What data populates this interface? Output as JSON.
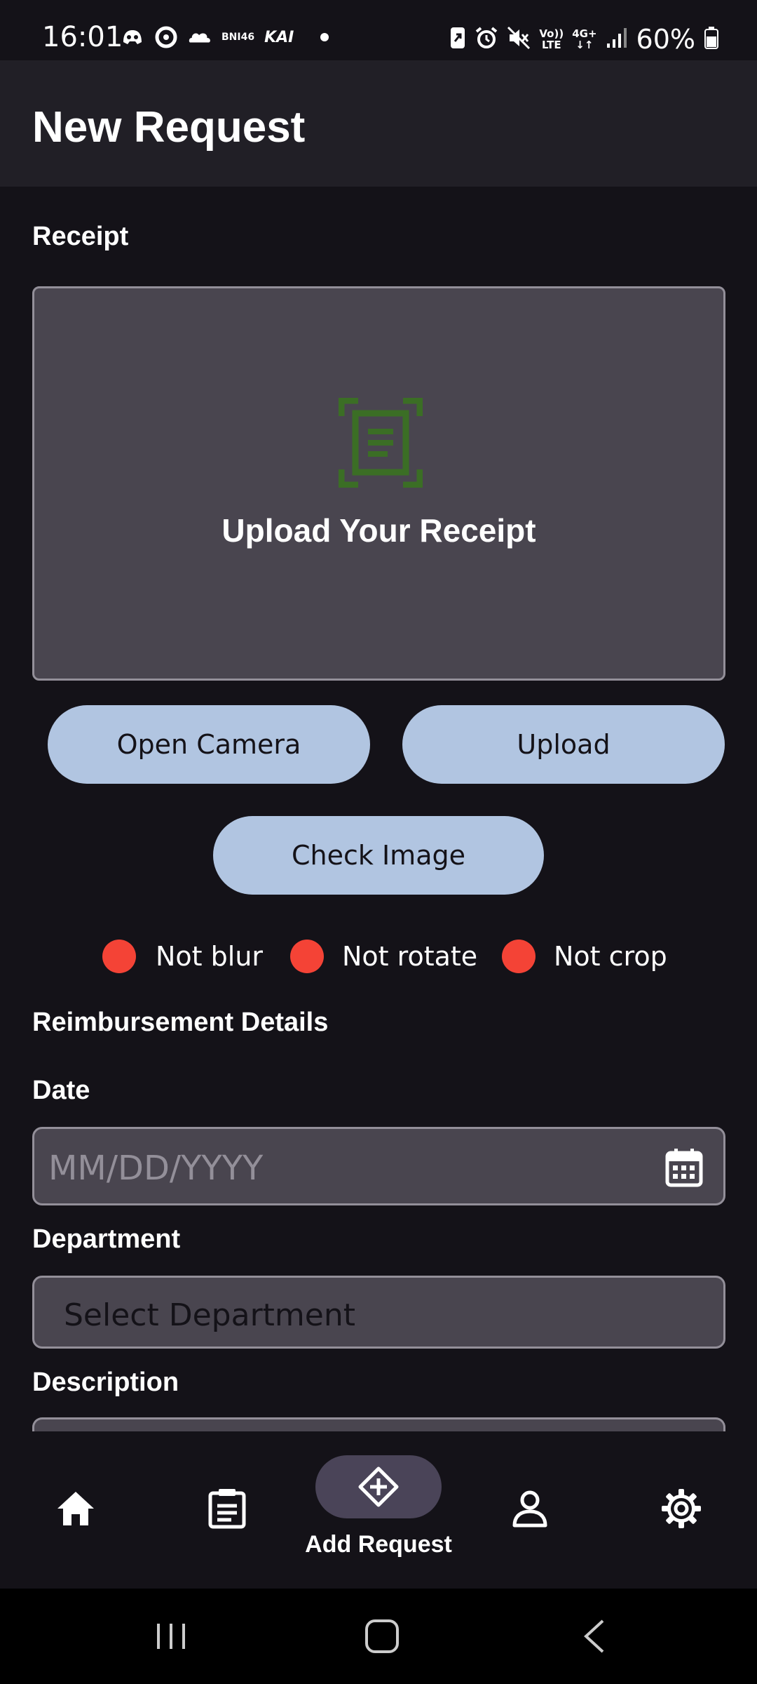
{
  "status_bar": {
    "time": "16:01",
    "carrier_tag": "BNI46",
    "brand_tag": "KAI",
    "network_top": "Vo))",
    "network_bottom": "LTE",
    "network_gen": "4G+",
    "battery": "60%",
    "icons": [
      "discord-icon",
      "target-icon",
      "cloud-icon",
      "bni-icon",
      "kai-icon",
      "notification-dot",
      "battery-saver-icon",
      "alarm-icon",
      "mute-icon",
      "volte-icon",
      "4g-icon",
      "signal-icon",
      "battery-icon"
    ]
  },
  "app_bar": {
    "title": "New Request"
  },
  "receipt": {
    "label": "Receipt",
    "upload_title": "Upload Your Receipt",
    "icon": "document-scan-icon",
    "icon_color": "#3b6e25"
  },
  "buttons": {
    "open_camera": "Open Camera",
    "upload": "Upload",
    "check_image": "Check Image"
  },
  "checks": [
    {
      "label": "Not blur",
      "status_color": "#f44336"
    },
    {
      "label": "Not rotate",
      "status_color": "#f44336"
    },
    {
      "label": "Not crop",
      "status_color": "#f44336"
    }
  ],
  "details": {
    "title": "Reimbursement Details",
    "date_label": "Date",
    "date_placeholder": "MM/DD/YYYY",
    "department_label": "Department",
    "department_value": "Select Department",
    "description_label": "Description"
  },
  "bottom_nav": {
    "items": [
      "home-icon",
      "list-icon",
      "add-request-icon",
      "profile-icon",
      "settings-icon"
    ],
    "active_label": "Add Request"
  },
  "colors": {
    "background": "#141218",
    "app_bar": "#211f26",
    "surface": "#49454f",
    "button": "#b1c5e1",
    "error": "#f44336"
  }
}
